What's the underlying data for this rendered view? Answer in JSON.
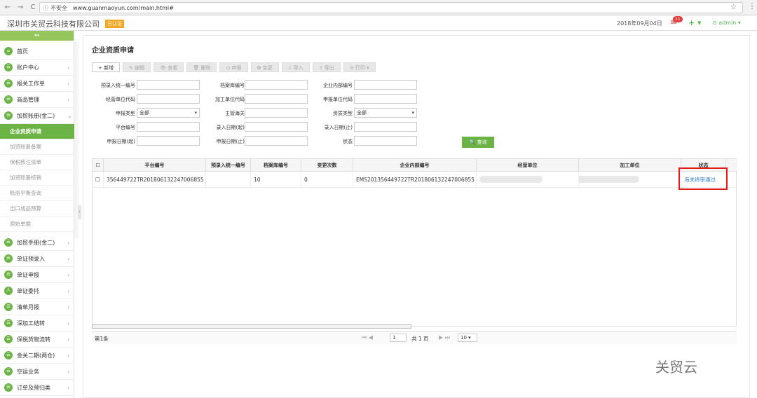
{
  "browser": {
    "back": "←",
    "forward": "→",
    "reload": "C",
    "info": "ⓘ",
    "insecure": "不安全",
    "url": "www.guanmaoyun.com/main.html#",
    "star": "☆",
    "menu": "⋮"
  },
  "topbar": {
    "company": "深圳市关贸云科技有限公司",
    "certified": "已认证",
    "date": "2018年09月04日",
    "badge": "11",
    "plus": "+ ▾",
    "user": "⊙ admin ▾"
  },
  "sidebar": {
    "head": "↔",
    "items": [
      {
        "label": "首页",
        "arrow": ""
      },
      {
        "label": "账户中心",
        "arrow": "›"
      },
      {
        "label": "报关工作单",
        "arrow": "›"
      },
      {
        "label": "商品管理",
        "arrow": "›"
      },
      {
        "label": "加贸账册(金二)",
        "arrow": "⌄"
      }
    ],
    "sub": [
      {
        "label": "企业资质申请"
      },
      {
        "label": "加贸账册备案"
      },
      {
        "label": "保税核注清单"
      },
      {
        "label": "加贸账册核销"
      },
      {
        "label": "账册平衡查询"
      },
      {
        "label": "出口成品预算"
      },
      {
        "label": "原始单据"
      }
    ],
    "items2": [
      {
        "label": "加贸手册(金二)",
        "arrow": "›"
      },
      {
        "label": "单证预录入",
        "arrow": "›"
      },
      {
        "label": "单证申报",
        "arrow": "›"
      },
      {
        "label": "单证委托",
        "arrow": "›"
      },
      {
        "label": "清单月报",
        "arrow": "›"
      },
      {
        "label": "深加工结转",
        "arrow": "›"
      },
      {
        "label": "保税货物流转",
        "arrow": "›"
      },
      {
        "label": "金关二期(两仓)",
        "arrow": "›"
      },
      {
        "label": "空运业务",
        "arrow": "›"
      },
      {
        "label": "订单及预归类",
        "arrow": "›"
      }
    ]
  },
  "main": {
    "title": "企业资质申请",
    "toolbar": [
      "+ 新增",
      "✎ 编辑",
      "👁 查看",
      "🗑 删除",
      "⊙ 申报",
      "✿ 变更",
      "⇩ 导入",
      "⇧ 导出",
      "⊖ 打印 ▾"
    ],
    "form": [
      {
        "label": "预录入统一编号",
        "value": ""
      },
      {
        "label": "档案库编号",
        "value": ""
      },
      {
        "label": "企业内部编号",
        "value": ""
      },
      {
        "label": "经营单位代码",
        "value": ""
      },
      {
        "label": "加工单位代码",
        "value": ""
      },
      {
        "label": "申报单位代码",
        "value": ""
      },
      {
        "label": "申报类型",
        "value": "全部"
      },
      {
        "label": "主管海关",
        "value": ""
      },
      {
        "label": "资质类型",
        "value": "全部"
      },
      {
        "label": "平台编号",
        "value": ""
      },
      {
        "label": "录入日期(起)",
        "value": ""
      },
      {
        "label": "录入日期(止)",
        "value": ""
      },
      {
        "label": "申报日期(起)",
        "value": ""
      },
      {
        "label": "申报日期(止)",
        "value": ""
      },
      {
        "label": "状态",
        "value": ""
      }
    ],
    "query": "🔍 查询",
    "table": {
      "headers": [
        "",
        "平台编号",
        "预录入统一编号",
        "档案库编号",
        "变更次数",
        "企业内部编号",
        "经营单位",
        "加工单位",
        "状态"
      ],
      "row": [
        "",
        "356449722TR201806132247006855",
        "",
        "10",
        "0",
        "EMS201356449722TR201806132247006855",
        "",
        "",
        "海关终审通过"
      ]
    },
    "footer": {
      "info": "第1条",
      "nav1": "⏮ ◀",
      "page": "1",
      "total": "共 1 页",
      "nav2": "▶ ⏭",
      "size": "10 ▾"
    }
  },
  "watermark": "关贸云"
}
